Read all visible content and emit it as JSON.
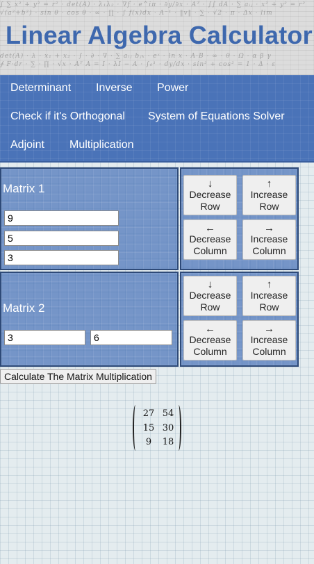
{
  "header": {
    "title": "Linear Algebra Calculator"
  },
  "nav": {
    "items": [
      "Determinant",
      "Inverse",
      "Power",
      "Check if it's Orthogonal",
      "System of Equations Solver",
      "Adjoint",
      "Multiplication"
    ]
  },
  "matrix1": {
    "label": "Matrix 1",
    "cells": [
      "9",
      "5",
      "3"
    ]
  },
  "matrix2": {
    "label": "Matrix 2",
    "cells": [
      "3",
      "6"
    ]
  },
  "controls": {
    "arrow_down": "↓",
    "arrow_up": "↑",
    "arrow_left": "←",
    "arrow_right": "→",
    "decrease": "Decrease",
    "increase": "Increase",
    "row": "Row",
    "column": "Column"
  },
  "calculate": {
    "label": "Calculate The Matrix Multiplication"
  },
  "result": {
    "rows": [
      [
        "27",
        "54"
      ],
      [
        "15",
        "30"
      ],
      [
        "9",
        "18"
      ]
    ]
  }
}
